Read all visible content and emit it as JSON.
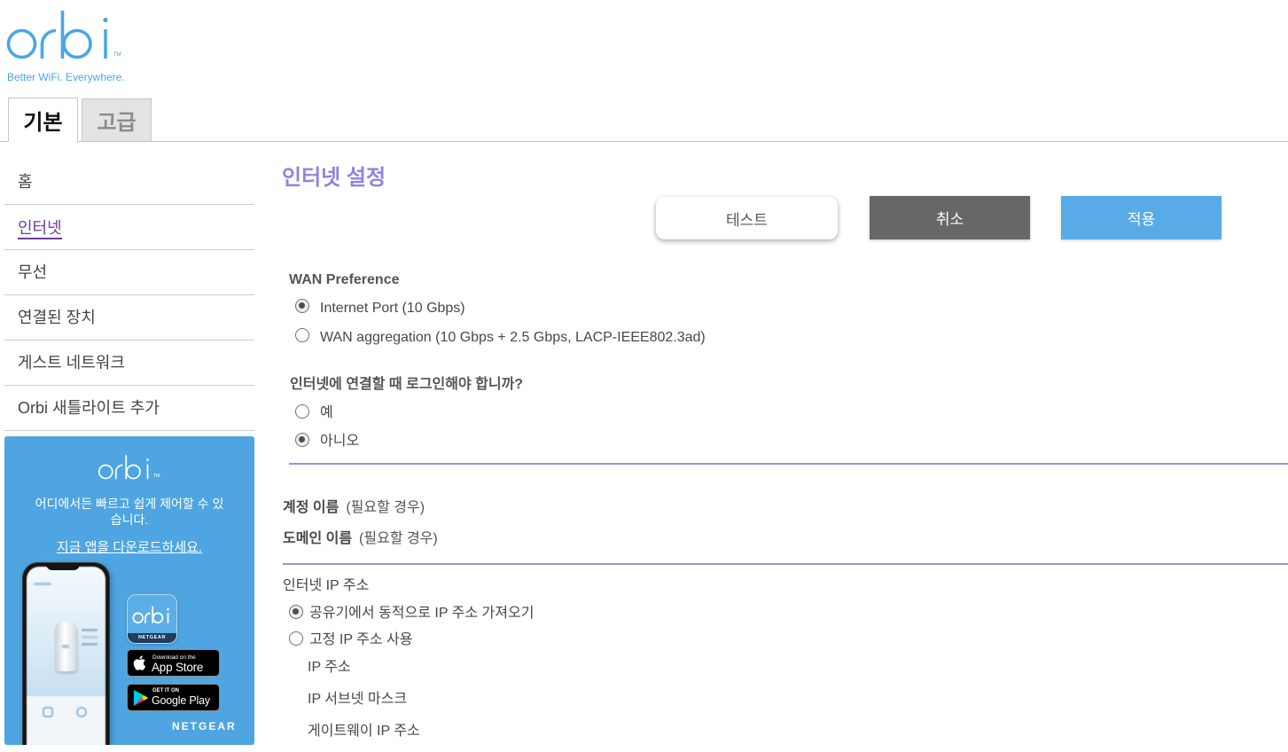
{
  "brand": {
    "logo_text": "orbi",
    "trademark": "TM",
    "tagline": "Better WiFi. Everywhere."
  },
  "tabs": [
    {
      "label": "기본",
      "active": true
    },
    {
      "label": "고급",
      "active": false
    }
  ],
  "sidebar": {
    "items": [
      {
        "label": "홈",
        "active": false
      },
      {
        "label": "인터넷",
        "active": true
      },
      {
        "label": "무선",
        "active": false
      },
      {
        "label": "연결된 장치",
        "active": false
      },
      {
        "label": "게스트 네트워크",
        "active": false
      },
      {
        "label": "Orbi 새틀라이트 추가",
        "active": false
      }
    ]
  },
  "promo": {
    "logo_text": "orbi",
    "trademark": "TM",
    "description": "어디에서든 빠르고 쉽게 제어할 수 있습니다.",
    "download_link": "지금 앱을 다운로드하세요.",
    "app_icon": {
      "logo_text": "orbi",
      "brand": "NETGEAR"
    },
    "app_store": {
      "icon": "apple-icon",
      "small_text": "Download on the",
      "large_text": "App Store"
    },
    "google_play": {
      "icon": "google-play-icon",
      "small_text": "GET IT ON",
      "large_text": "Google Play"
    },
    "brand": "NETGEAR"
  },
  "main": {
    "title": "인터넷 설정",
    "buttons": {
      "test": "테스트",
      "cancel": "취소",
      "apply": "적용"
    },
    "wan_preference": {
      "heading": "WAN Preference",
      "options": [
        {
          "label": "Internet Port (10 Gbps)",
          "checked": true
        },
        {
          "label": "WAN aggregation (10 Gbps + 2.5 Gbps, LACP-IEEE802.3ad)",
          "checked": false
        }
      ]
    },
    "login_required": {
      "question": "인터넷에 연결할 때 로그인해야 합니까?",
      "options": [
        {
          "label": "예",
          "checked": false
        },
        {
          "label": "아니오",
          "checked": true
        }
      ]
    },
    "account_name": {
      "label": "계정 이름",
      "hint": "(필요할 경우)"
    },
    "domain_name": {
      "label": "도메인 이름",
      "hint": "(필요할 경우)"
    },
    "internet_ip": {
      "heading": "인터넷 IP 주소",
      "options": [
        {
          "label": "공유기에서 동적으로 IP 주소 가져오기",
          "checked": true
        },
        {
          "label": "고정 IP 주소 사용",
          "checked": false
        }
      ],
      "static_fields": {
        "ip_address": "IP 주소",
        "subnet_mask": "IP 서브넷 마스크",
        "gateway": "게이트웨이 IP 주소"
      }
    }
  },
  "colors": {
    "brand_blue": "#4aa6e4",
    "accent_purple": "#9282dd",
    "active_nav": "#6a3c9c",
    "divider_purple": "#9c90e6",
    "cancel_button": "#676767",
    "apply_button": "#59abe7",
    "promo_background": "#4ea5e1"
  }
}
